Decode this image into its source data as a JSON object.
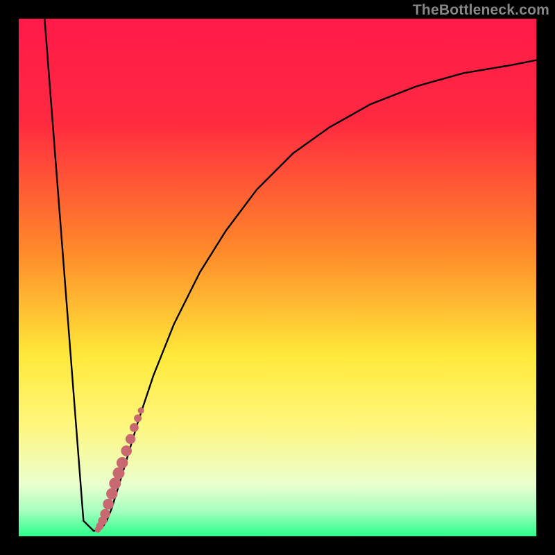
{
  "watermark": "TheBottleneck.com",
  "colors": {
    "frame": "#000000",
    "grad_top": "#ff1a4a",
    "grad_red": "#ff2a40",
    "grad_orange": "#ff8a2a",
    "grad_yellow": "#ffe93a",
    "grad_yellow_soft": "#fff67a",
    "grad_pale": "#eaffce",
    "grad_green": "#2aff8a",
    "curve": "#000000",
    "points": "#c86870"
  },
  "chart_data": {
    "type": "line",
    "title": "",
    "xlabel": "",
    "ylabel": "",
    "xlim": [
      0,
      100
    ],
    "ylim": [
      0,
      100
    ],
    "series": [
      {
        "name": "bottleneck-curve",
        "x": [
          5,
          12.5,
          14.5,
          16,
          17,
          18,
          20,
          23,
          26,
          30,
          35,
          40,
          46,
          53,
          60,
          68,
          77,
          86,
          95,
          100
        ],
        "y": [
          100,
          3,
          1,
          1.5,
          3,
          5.5,
          12,
          22,
          31,
          41,
          51,
          59,
          67,
          74,
          79,
          83.5,
          87,
          89.5,
          91,
          92
        ]
      }
    ],
    "scatter": {
      "name": "highlight-points",
      "x": [
        15.3,
        15.7,
        16.2,
        16.7,
        17.3,
        18.0,
        18.6,
        19.3,
        20.0,
        20.8,
        21.6,
        22.3,
        23.0,
        23.6
      ],
      "y": [
        1.3,
        2.0,
        3.0,
        4.3,
        6.2,
        8.2,
        10.2,
        12.2,
        14.2,
        16.5,
        18.8,
        21.0,
        22.8,
        24.3
      ]
    },
    "gradient_stops_pct": [
      0,
      20,
      45,
      65,
      78,
      90,
      95,
      100
    ]
  }
}
